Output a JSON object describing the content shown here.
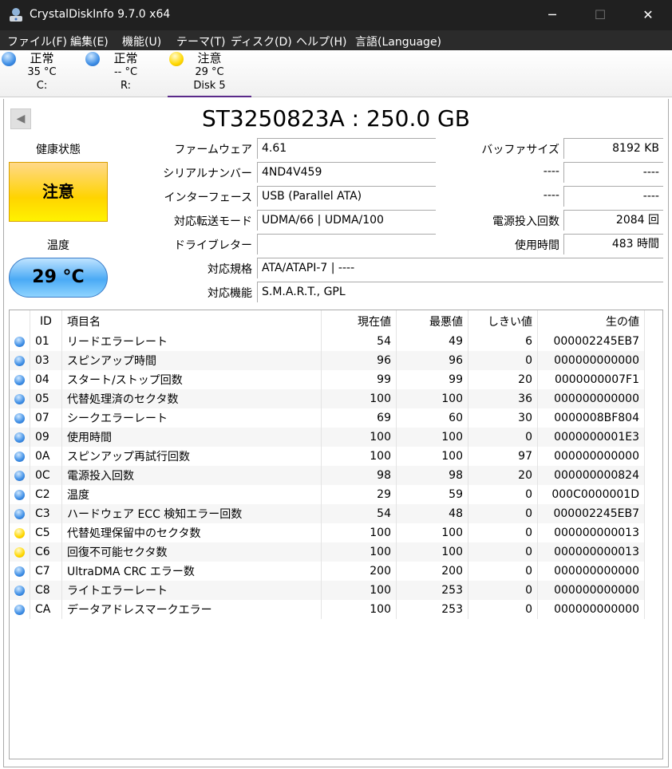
{
  "window": {
    "title": "CrystalDiskInfo 9.7.0 x64",
    "minimize": "─",
    "maximize": "☐",
    "close": "✕"
  },
  "menu": [
    "ファイル(F)",
    "編集(E)",
    "機能(U)",
    "テーマ(T)",
    "ディスク(D)",
    "ヘルプ(H)",
    "言語(Language)"
  ],
  "disks": [
    {
      "status": "正常",
      "temp": "35 °C",
      "name": "C:",
      "color": "blue"
    },
    {
      "status": "正常",
      "temp": "-- °C",
      "name": "R:",
      "color": "blue"
    },
    {
      "status": "注意",
      "temp": "29 °C",
      "name": "Disk 5",
      "color": "yellow"
    }
  ],
  "model": "ST3250823A : 250.0 GB",
  "prev_button": "◀",
  "health": {
    "label": "健康状態",
    "value": "注意"
  },
  "temperature": {
    "label": "温度",
    "value": "29 °C"
  },
  "info": {
    "firmware": {
      "label": "ファームウェア",
      "value": "4.61"
    },
    "serial": {
      "label": "シリアルナンバー",
      "value": "4ND4V459"
    },
    "interface": {
      "label": "インターフェース",
      "value": "USB (Parallel ATA)"
    },
    "transfer": {
      "label": "対応転送モード",
      "value": "UDMA/66 | UDMA/100"
    },
    "drive_letter": {
      "label": "ドライブレター",
      "value": ""
    },
    "standard": {
      "label": "対応規格",
      "value": "ATA/ATAPI-7 | ----"
    },
    "features": {
      "label": "対応機能",
      "value": "S.M.A.R.T., GPL"
    },
    "buffer": {
      "label": "バッファサイズ",
      "value": "8192 KB"
    },
    "r2": {
      "label": "----",
      "value": "----"
    },
    "r3": {
      "label": "----",
      "value": "----"
    },
    "power_count": {
      "label": "電源投入回数",
      "value": "2084 回"
    },
    "power_hours": {
      "label": "使用時間",
      "value": "483 時間"
    }
  },
  "smart": {
    "headers": [
      "ID",
      "項目名",
      "現在値",
      "最悪値",
      "しきい値",
      "生の値"
    ],
    "rows": [
      [
        "01",
        "リードエラーレート",
        "54",
        "49",
        "6",
        "000002245EB7",
        "blue"
      ],
      [
        "03",
        "スピンアップ時間",
        "96",
        "96",
        "0",
        "000000000000",
        "blue"
      ],
      [
        "04",
        "スタート/ストップ回数",
        "99",
        "99",
        "20",
        "0000000007F1",
        "blue"
      ],
      [
        "05",
        "代替処理済のセクタ数",
        "100",
        "100",
        "36",
        "000000000000",
        "blue"
      ],
      [
        "07",
        "シークエラーレート",
        "69",
        "60",
        "30",
        "0000008BF804",
        "blue"
      ],
      [
        "09",
        "使用時間",
        "100",
        "100",
        "0",
        "0000000001E3",
        "blue"
      ],
      [
        "0A",
        "スピンアップ再試行回数",
        "100",
        "100",
        "97",
        "000000000000",
        "blue"
      ],
      [
        "0C",
        "電源投入回数",
        "98",
        "98",
        "20",
        "000000000824",
        "blue"
      ],
      [
        "C2",
        "温度",
        "29",
        "59",
        "0",
        "000C0000001D",
        "blue"
      ],
      [
        "C3",
        "ハードウェア ECC 検知エラー回数",
        "54",
        "48",
        "0",
        "000002245EB7",
        "blue"
      ],
      [
        "C5",
        "代替処理保留中のセクタ数",
        "100",
        "100",
        "0",
        "000000000013",
        "yellow"
      ],
      [
        "C6",
        "回復不可能セクタ数",
        "100",
        "100",
        "0",
        "000000000013",
        "yellow"
      ],
      [
        "C7",
        "UltraDMA CRC エラー数",
        "200",
        "200",
        "0",
        "000000000000",
        "blue"
      ],
      [
        "C8",
        "ライトエラーレート",
        "100",
        "253",
        "0",
        "000000000000",
        "blue"
      ],
      [
        "CA",
        "データアドレスマークエラー",
        "100",
        "253",
        "0",
        "000000000000",
        "blue"
      ]
    ]
  }
}
